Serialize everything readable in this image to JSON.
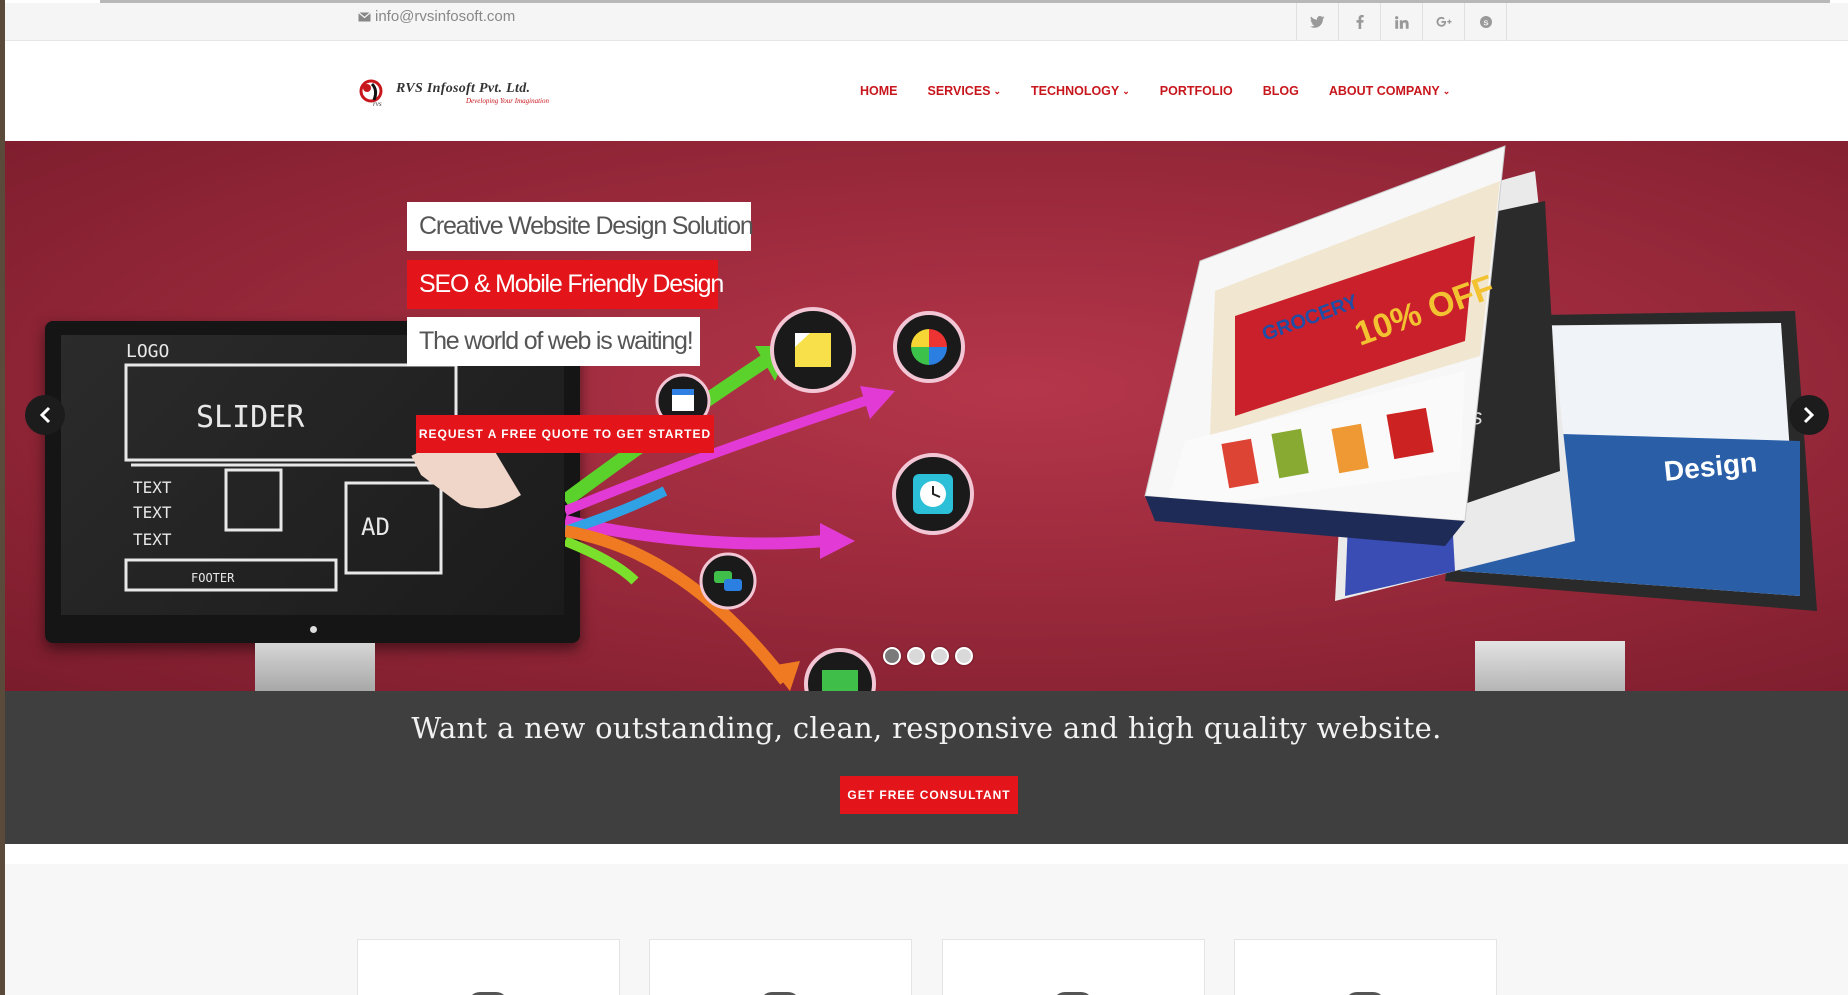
{
  "topbar": {
    "email": "info@rvsinfosoft.com",
    "social_icons": [
      "twitter-icon",
      "facebook-icon",
      "linkedin-icon",
      "google-plus-icon",
      "skype-icon"
    ]
  },
  "brand": {
    "name": "RVS Infosoft Pvt. Ltd.",
    "tagline": "Developing Your Imagination"
  },
  "nav": {
    "items": [
      {
        "label": "HOME",
        "dropdown": false
      },
      {
        "label": "SERVICES",
        "dropdown": true
      },
      {
        "label": "TECHNOLOGY",
        "dropdown": true
      },
      {
        "label": "PORTFOLIO",
        "dropdown": false
      },
      {
        "label": "BLOG",
        "dropdown": false
      },
      {
        "label": "ABOUT COMPANY",
        "dropdown": true
      }
    ]
  },
  "slider": {
    "captions": [
      "Creative Website Design Solution",
      "SEO & Mobile Friendly Design",
      "The world of web is waiting!"
    ],
    "cta_label": "REQUEST A FREE QUOTE TO GET STARTED",
    "prev_icon": "chevron-left-icon",
    "next_icon": "chevron-right-icon",
    "slide_count": 4,
    "active_slide": 1,
    "sketch": {
      "logo": "LOGO",
      "slider": "SLIDER",
      "text": "TEXT",
      "ad": "AD",
      "footer": "FOOTER"
    },
    "promo": {
      "store": "GROCERY",
      "discount": "10% OFF",
      "brand_word": "Design"
    }
  },
  "cta": {
    "headline": "Want a new outstanding, clean, responsive and high quality website.",
    "button_label": "GET FREE CONSULTANT"
  },
  "colors": {
    "accent": "#e3151b",
    "hero_bg": "#9b2a3c",
    "cta_bg": "#3f3f3f"
  }
}
